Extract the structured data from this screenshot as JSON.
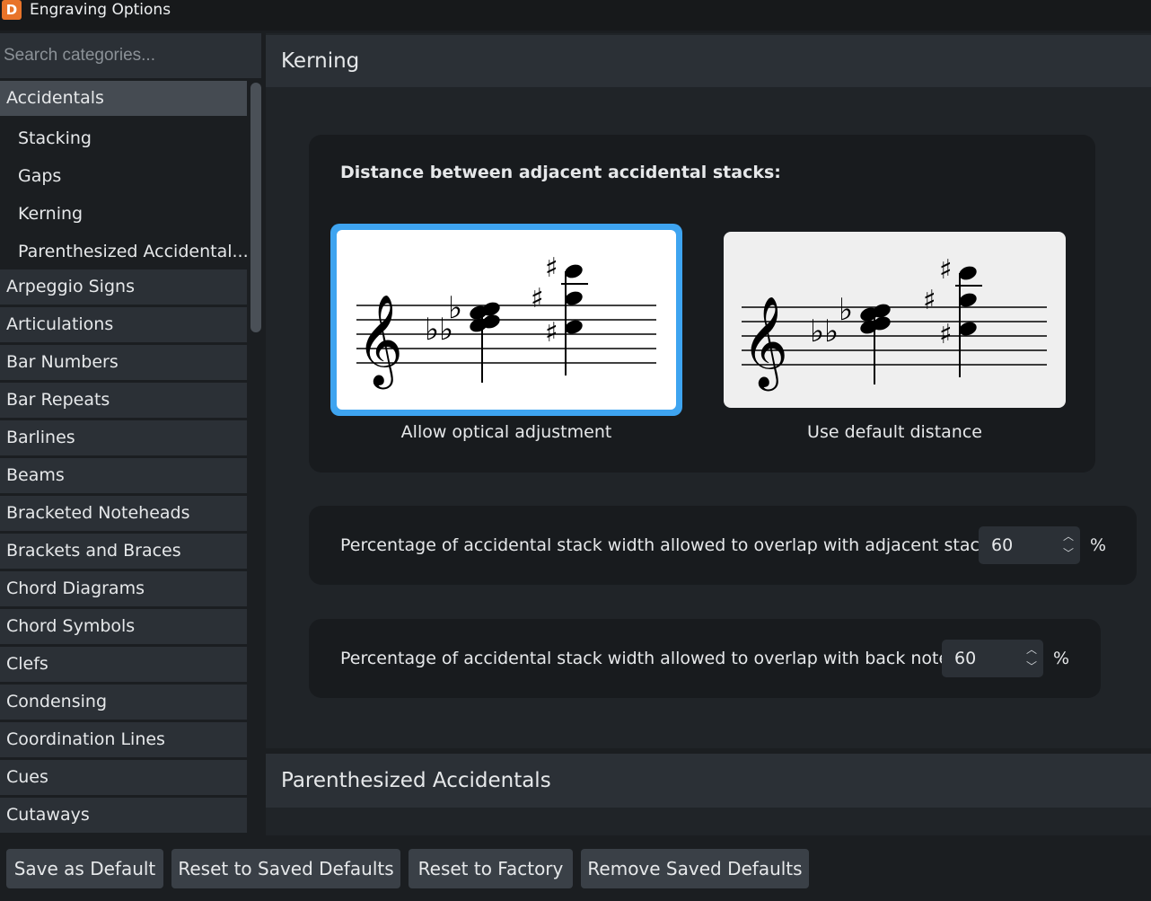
{
  "window": {
    "title": "Engraving Options",
    "app_icon": "D"
  },
  "search": {
    "placeholder": "Search categories..."
  },
  "sidebar": {
    "selected": "Accidentals",
    "subitems": [
      "Stacking",
      "Gaps",
      "Kerning",
      "Parenthesized Accidental..."
    ],
    "items": [
      "Accidentals",
      "Arpeggio Signs",
      "Articulations",
      "Bar Numbers",
      "Bar Repeats",
      "Barlines",
      "Beams",
      "Bracketed Noteheads",
      "Brackets and Braces",
      "Chord Diagrams",
      "Chord Symbols",
      "Clefs",
      "Condensing",
      "Coordination Lines",
      "Cues",
      "Cutaways"
    ]
  },
  "kerning": {
    "header": "Kerning",
    "distance_label": "Distance between adjacent accidental stacks:",
    "options": [
      {
        "caption": "Allow optical adjustment",
        "selected": true
      },
      {
        "caption": "Use default distance",
        "selected": false
      }
    ],
    "overlap_adjacent": {
      "label": "Percentage of accidental stack width allowed to overlap with adjacent stack:",
      "value": "60",
      "unit": "%"
    },
    "overlap_back": {
      "label": "Percentage of accidental stack width allowed to overlap with back note:",
      "value": "60",
      "unit": "%"
    }
  },
  "parenthesized": {
    "header": "Parenthesized Accidentals"
  },
  "footer": {
    "save_default": "Save as Default",
    "reset_saved": "Reset to Saved Defaults",
    "reset_factory": "Reset to Factory",
    "remove_saved": "Remove Saved Defaults"
  },
  "colors": {
    "selection_accent": "#3ea4f0",
    "background": "#1b1e21",
    "panel": "#2b3036"
  },
  "glyphs": {
    "treble_clef": "𝄞",
    "flat": "♭",
    "sharp": "♯"
  }
}
